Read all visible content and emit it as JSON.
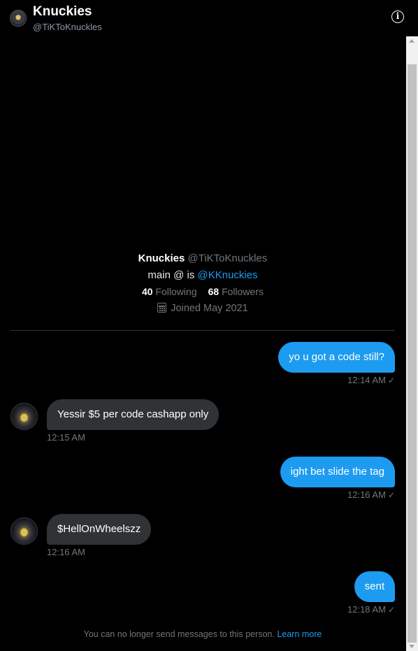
{
  "header": {
    "name": "Knuckies",
    "handle": "@TiKToKnuckles",
    "info_icon": "info-icon",
    "info_glyph": "i"
  },
  "profile": {
    "name": "Knuckies",
    "handle": "@TiKToKnuckles",
    "bio_prefix": "main @ is ",
    "bio_link": "@KKnuckies",
    "following_count": "40",
    "following_label": "Following",
    "followers_count": "68",
    "followers_label": "Followers",
    "joined": "Joined May 2021"
  },
  "messages": [
    {
      "direction": "sent",
      "text": "yo u got a code still?",
      "time": "12:14 AM",
      "status_icon": "check-icon"
    },
    {
      "direction": "received",
      "text": "Yessir $5 per code cashapp only",
      "time": "12:15 AM"
    },
    {
      "direction": "sent",
      "text": "ight bet slide the tag",
      "time": "12:16 AM",
      "status_icon": "check-icon"
    },
    {
      "direction": "received",
      "text": "$HellOnWheelszz",
      "time": "12:16 AM"
    },
    {
      "direction": "sent",
      "text": "sent",
      "time": "12:18 AM",
      "status_icon": "check-icon"
    }
  ],
  "footer": {
    "notice": "You can no longer send messages to this person.",
    "learn_more": "Learn more"
  },
  "colors": {
    "background": "#000000",
    "sent_bubble": "#1d9bf0",
    "received_bubble": "#2f3336",
    "link": "#1d9bf0",
    "muted_text": "#71767b"
  }
}
